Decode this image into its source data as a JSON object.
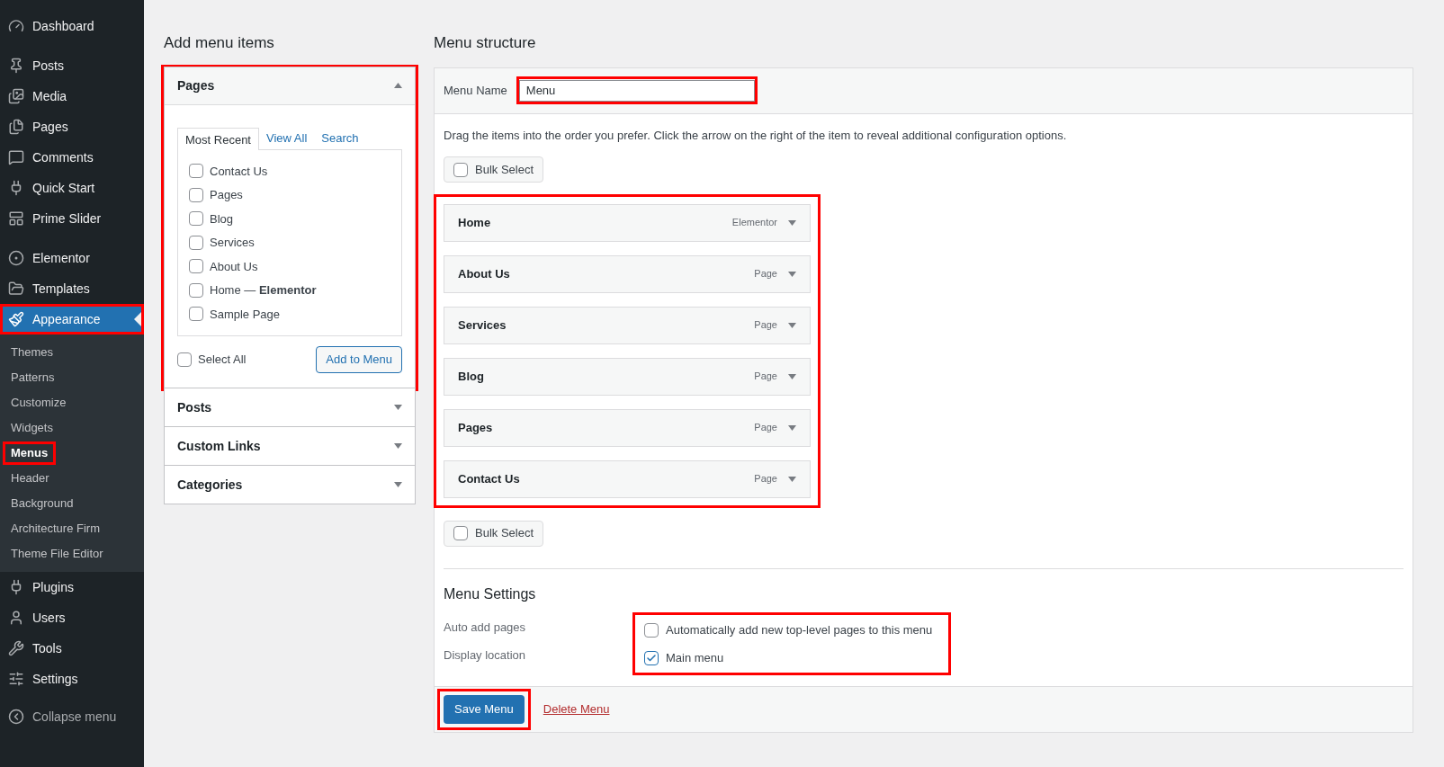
{
  "sidebar": {
    "groups": [
      [
        {
          "label": "Dashboard",
          "selected": false,
          "highlighted": false
        }
      ],
      [
        {
          "label": "Posts",
          "selected": false,
          "highlighted": false
        },
        {
          "label": "Media",
          "selected": false,
          "highlighted": false
        },
        {
          "label": "Pages",
          "selected": false,
          "highlighted": false
        },
        {
          "label": "Comments",
          "selected": false,
          "highlighted": false
        },
        {
          "label": "Quick Start",
          "selected": false,
          "highlighted": false
        },
        {
          "label": "Prime Slider",
          "selected": false,
          "highlighted": false
        }
      ],
      [
        {
          "label": "Elementor",
          "selected": false,
          "highlighted": false
        },
        {
          "label": "Templates",
          "selected": false,
          "highlighted": false
        },
        {
          "label": "Appearance",
          "selected": true,
          "highlighted": true,
          "submenu": [
            {
              "label": "Themes",
              "selected": false,
              "highlighted": false
            },
            {
              "label": "Patterns",
              "selected": false,
              "highlighted": false
            },
            {
              "label": "Customize",
              "selected": false,
              "highlighted": false
            },
            {
              "label": "Widgets",
              "selected": false,
              "highlighted": false
            },
            {
              "label": "Menus",
              "selected": true,
              "highlighted": true
            },
            {
              "label": "Header",
              "selected": false,
              "highlighted": false
            },
            {
              "label": "Background",
              "selected": false,
              "highlighted": false
            },
            {
              "label": "Architecture Firm",
              "selected": false,
              "highlighted": false
            },
            {
              "label": "Theme File Editor",
              "selected": false,
              "highlighted": false
            }
          ]
        },
        {
          "label": "Plugins",
          "selected": false,
          "highlighted": false
        },
        {
          "label": "Users",
          "selected": false,
          "highlighted": false
        },
        {
          "label": "Tools",
          "selected": false,
          "highlighted": false
        },
        {
          "label": "Settings",
          "selected": false,
          "highlighted": false
        }
      ]
    ],
    "collapse_label": "Collapse menu"
  },
  "add_items": {
    "heading": "Add menu items",
    "sections": [
      {
        "title": "Pages",
        "expanded": true,
        "highlighted": true,
        "tabs": [
          {
            "label": "Most Recent",
            "selected": true
          },
          {
            "label": "View All",
            "selected": false
          },
          {
            "label": "Search",
            "selected": false
          }
        ],
        "items": [
          {
            "label": "Contact Us",
            "checked": false
          },
          {
            "label": "Pages",
            "checked": false
          },
          {
            "label": "Blog",
            "checked": false
          },
          {
            "label": "Services",
            "checked": false
          },
          {
            "label": "About Us",
            "checked": false
          },
          {
            "label": "Home — **Elementor**",
            "checked": false
          },
          {
            "label": "Sample Page",
            "checked": false
          }
        ],
        "select_all": {
          "label": "Select All",
          "checked": false
        },
        "add_button": "Add to Menu"
      },
      {
        "title": "Posts",
        "expanded": false,
        "highlighted": false
      },
      {
        "title": "Custom Links",
        "expanded": false,
        "highlighted": false
      },
      {
        "title": "Categories",
        "expanded": false,
        "highlighted": false
      }
    ]
  },
  "menu_structure": {
    "heading": "Menu structure",
    "menu_name": {
      "label": "Menu Name",
      "value": "Menu",
      "highlighted": true
    },
    "instructions": "Drag the items into the order you prefer. Click the arrow on the right of the item to reveal additional configuration options.",
    "bulk_select_top": {
      "label": "Bulk Select",
      "checked": false
    },
    "items_highlighted": true,
    "items": [
      {
        "title": "Home",
        "type": "Elementor"
      },
      {
        "title": "About Us",
        "type": "Page"
      },
      {
        "title": "Services",
        "type": "Page"
      },
      {
        "title": "Blog",
        "type": "Page"
      },
      {
        "title": "Pages",
        "type": "Page"
      },
      {
        "title": "Contact Us",
        "type": "Page"
      }
    ],
    "bulk_select_bottom": {
      "label": "Bulk Select",
      "checked": false
    },
    "settings": {
      "heading": "Menu Settings",
      "highlighted": true,
      "rows": [
        {
          "label": "Auto add pages",
          "option": {
            "label": "Automatically add new top-level pages to this menu",
            "checked": false
          }
        },
        {
          "label": "Display location",
          "option": {
            "label": "Main menu",
            "checked": true
          }
        }
      ]
    },
    "save_button": {
      "label": "Save Menu",
      "highlighted": true
    },
    "delete_link": "Delete Menu"
  }
}
